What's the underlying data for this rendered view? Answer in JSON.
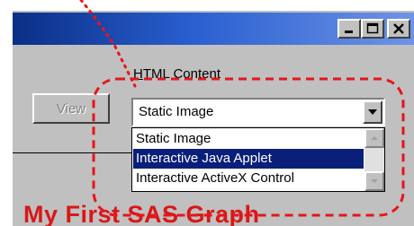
{
  "window": {
    "title_buttons": [
      {
        "name": "minimize-icon"
      },
      {
        "name": "maximize-icon"
      },
      {
        "name": "close-icon"
      }
    ]
  },
  "form": {
    "content_label_underlined": "H",
    "content_label_rest": "TML Content",
    "view_button_label": "View",
    "combo_value": "Static Image"
  },
  "dropdown": {
    "items": [
      {
        "label": "Static Image",
        "selected": false
      },
      {
        "label": "Interactive Java Applet",
        "selected": true
      },
      {
        "label": "Interactive ActiveX Control",
        "selected": false
      }
    ]
  },
  "page": {
    "headline": "My First SAS Graph"
  },
  "colors": {
    "highlight": "#0a1f7a",
    "callout": "#e8141b",
    "headline": "#d81818"
  }
}
